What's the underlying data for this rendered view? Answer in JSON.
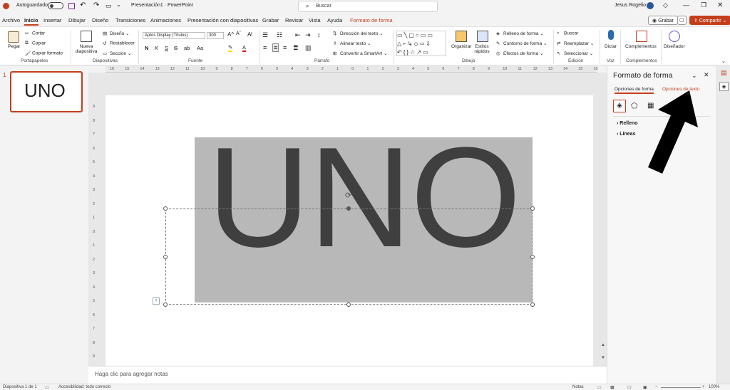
{
  "titlebar": {
    "autosave_label": "Autoguardado",
    "document_title": "Presentación1 · PowerPoint",
    "search_placeholder": "Buscar",
    "user_name": "Jesus Rogelio"
  },
  "menu": {
    "tabs": [
      "Archivo",
      "Inicio",
      "Insertar",
      "Dibujar",
      "Diseño",
      "Transiciones",
      "Animaciones",
      "Presentación con diapositivas",
      "Grabar",
      "Revisar",
      "Vista",
      "Ayuda",
      "Formato de forma"
    ],
    "active_tab": "Inicio",
    "record_label": "Grabar",
    "share_label": "Compartir"
  },
  "ribbon": {
    "clipboard": {
      "paste": "Pegar",
      "cut": "Cortar",
      "copy": "Copiar",
      "format_painter": "Copiar formato",
      "group": "Portapapeles"
    },
    "slides": {
      "new_slide": "Nueva diapositiva",
      "layout": "Diseño",
      "reset": "Restablecer",
      "section": "Sección",
      "group": "Diapositivas"
    },
    "font": {
      "font_name": "Aptos Display (Títulos)",
      "font_size": "300",
      "group": "Fuente"
    },
    "paragraph": {
      "text_direction": "Dirección del texto",
      "align_text": "Alinear texto",
      "smartart": "Convertir a SmartArt",
      "group": "Párrafo"
    },
    "drawing": {
      "arrange": "Organizar",
      "quick_styles": "Estilos rápidos",
      "fill": "Relleno de forma",
      "outline": "Contorno de forma",
      "effects": "Efectos de forma",
      "group": "Dibujo"
    },
    "editing": {
      "find": "Buscar",
      "replace": "Reemplazar",
      "select": "Seleccionar",
      "group": "Edición"
    },
    "voice": {
      "dictate": "Dictar",
      "group": "Voz"
    },
    "addins": {
      "addins": "Complementos",
      "group": "Complementos"
    },
    "designer": {
      "label": "Diseñador"
    }
  },
  "ruler": {
    "h_ticks": [
      "16",
      "15",
      "14",
      "13",
      "12",
      "11",
      "10",
      "9",
      "8",
      "7",
      "6",
      "5",
      "4",
      "3",
      "2",
      "1",
      "0",
      "1",
      "2",
      "3",
      "4",
      "5",
      "6",
      "7",
      "8",
      "9",
      "10",
      "11",
      "12",
      "13",
      "14",
      "15",
      "16"
    ],
    "v_ticks": [
      "9",
      "8",
      "7",
      "6",
      "5",
      "4",
      "3",
      "2",
      "1",
      "0",
      "1",
      "2",
      "3",
      "4",
      "5",
      "6",
      "7",
      "8",
      "9"
    ]
  },
  "thumbnail": {
    "number": "1",
    "text": "UNO"
  },
  "slide": {
    "text": "UNO",
    "notes_placeholder": "Haga clic para agregar notas"
  },
  "pane": {
    "title": "Formato de forma",
    "tab_shape": "Opciones de forma",
    "tab_text": "Opciones de texto",
    "fill": "Relleno",
    "lines": "Líneas"
  },
  "status": {
    "slide_info": "Diapositiva 1 de 1",
    "accessibility": "Accesibilidad: todo correcto",
    "notes": "Notas",
    "zoom": "100%"
  },
  "colors": {
    "accent": "#c43e1c",
    "shape_fill": "#b8b8b8",
    "text": "#3f3f3f"
  }
}
